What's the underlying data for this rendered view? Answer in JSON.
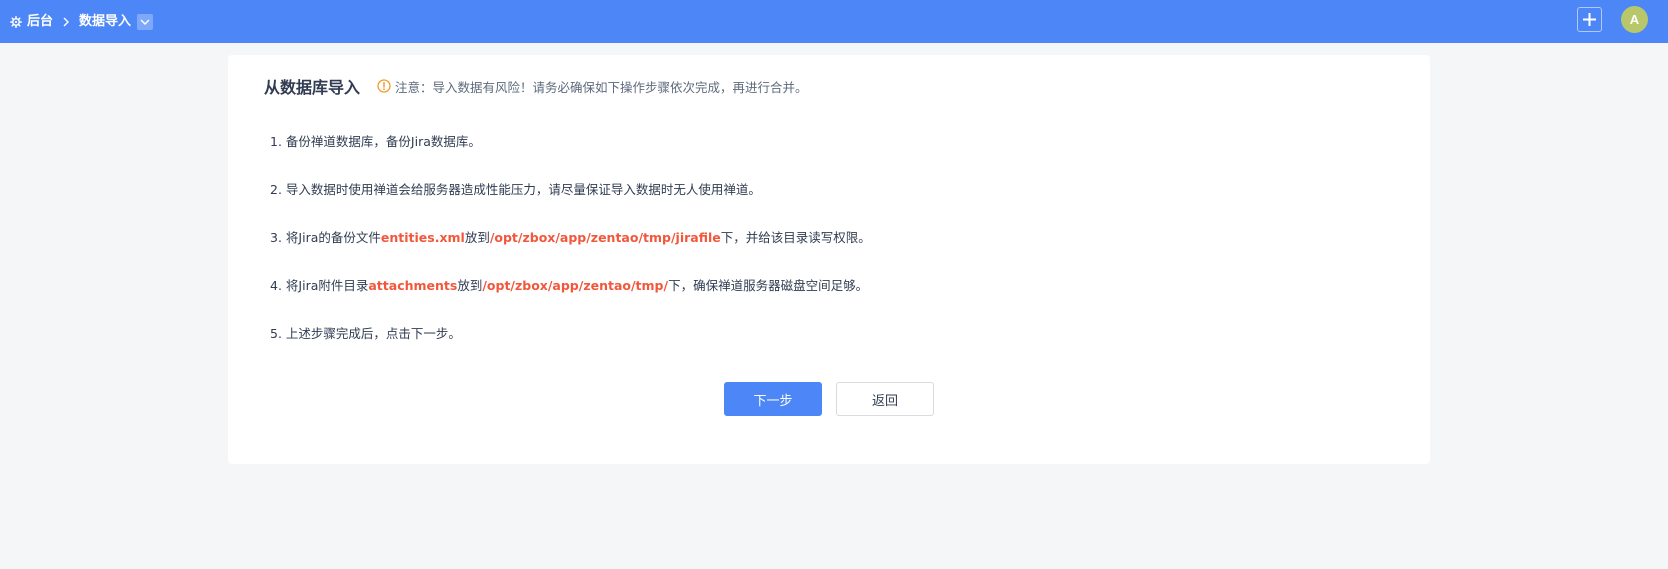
{
  "topbar": {
    "home_icon": "gear-icon",
    "crumb_home": "后台",
    "separator_icon": "chevron-right-icon",
    "crumb_current": "数据导入",
    "dropdown_icon": "chevron-down-icon",
    "add_icon": "plus-icon",
    "avatar_letter": "A",
    "bar_color": "#4d87f7"
  },
  "card": {
    "title": "从数据库导入",
    "warning_icon": "warning-circle-icon",
    "notice": "注意：导入数据有风险！请务必确保如下操作步骤依次完成，再进行合并。",
    "steps": [
      {
        "num": "1. ",
        "parts": [
          "备份禅道数据库，备份Jira数据库。"
        ]
      },
      {
        "num": "2. ",
        "parts": [
          "导入数据时使用禅道会给服务器造成性能压力，请尽量保证导入数据时无人使用禅道。"
        ]
      },
      {
        "num": "3. ",
        "a": "将Jira的备份文件",
        "b": "entities.xml",
        "c": "放到",
        "d": "/opt/zbox/app/zentao/tmp/jirafile",
        "e": "下，并给该目录读写权限。"
      },
      {
        "num": "4. ",
        "a": "将Jira附件目录",
        "b": "attachments",
        "c": "放到",
        "d": "/opt/zbox/app/zentao/tmp/",
        "e": "下，确保禅道服务器磁盘空间足够。"
      },
      {
        "num": "5. ",
        "parts": [
          "上述步骤完成后，点击下一步。"
        ]
      }
    ],
    "highlight_color": "#f2573c",
    "next_label": "下一步",
    "back_label": "返回"
  }
}
